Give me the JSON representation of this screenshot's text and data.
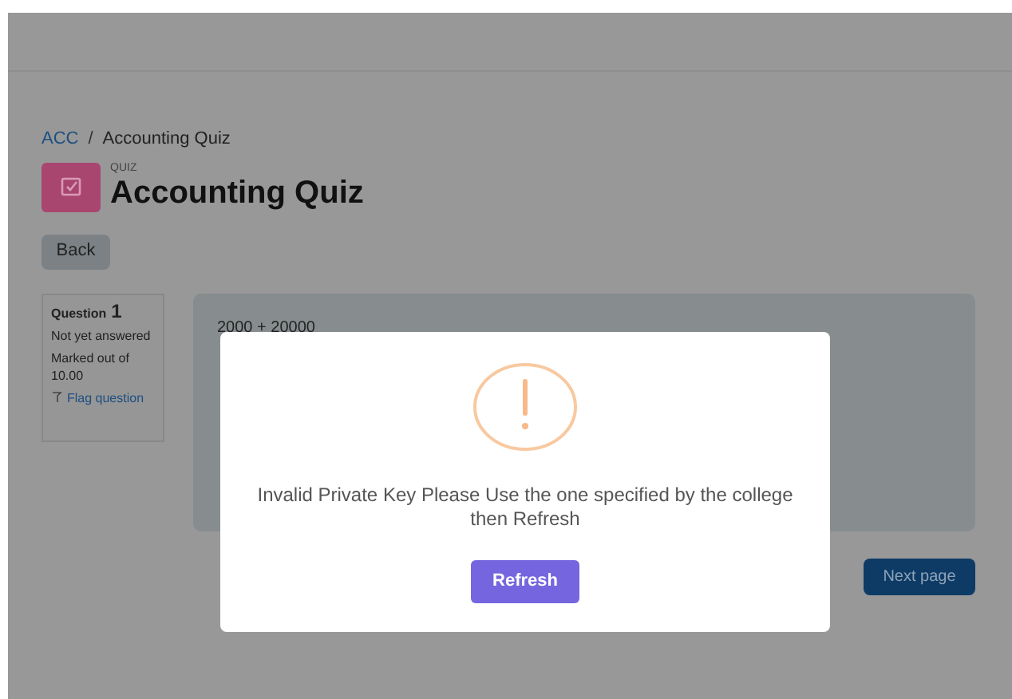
{
  "breadcrumb": [
    "ACC",
    "Accounting Quiz"
  ],
  "breadcrumb_separator": "/",
  "header": {
    "label": "QUIZ",
    "title": "Accounting Quiz"
  },
  "back_button": "Back",
  "question_info": {
    "label": "Question",
    "number": "1",
    "status": "Not yet answered",
    "marks": "Marked out of 10.00",
    "flag_link": "Flag question"
  },
  "question_text": "2000 + 20000",
  "next_button": "Next page",
  "dialog": {
    "message": "Invalid Private Key Please Use the one specified by the college then Refresh",
    "button": "Refresh"
  }
}
